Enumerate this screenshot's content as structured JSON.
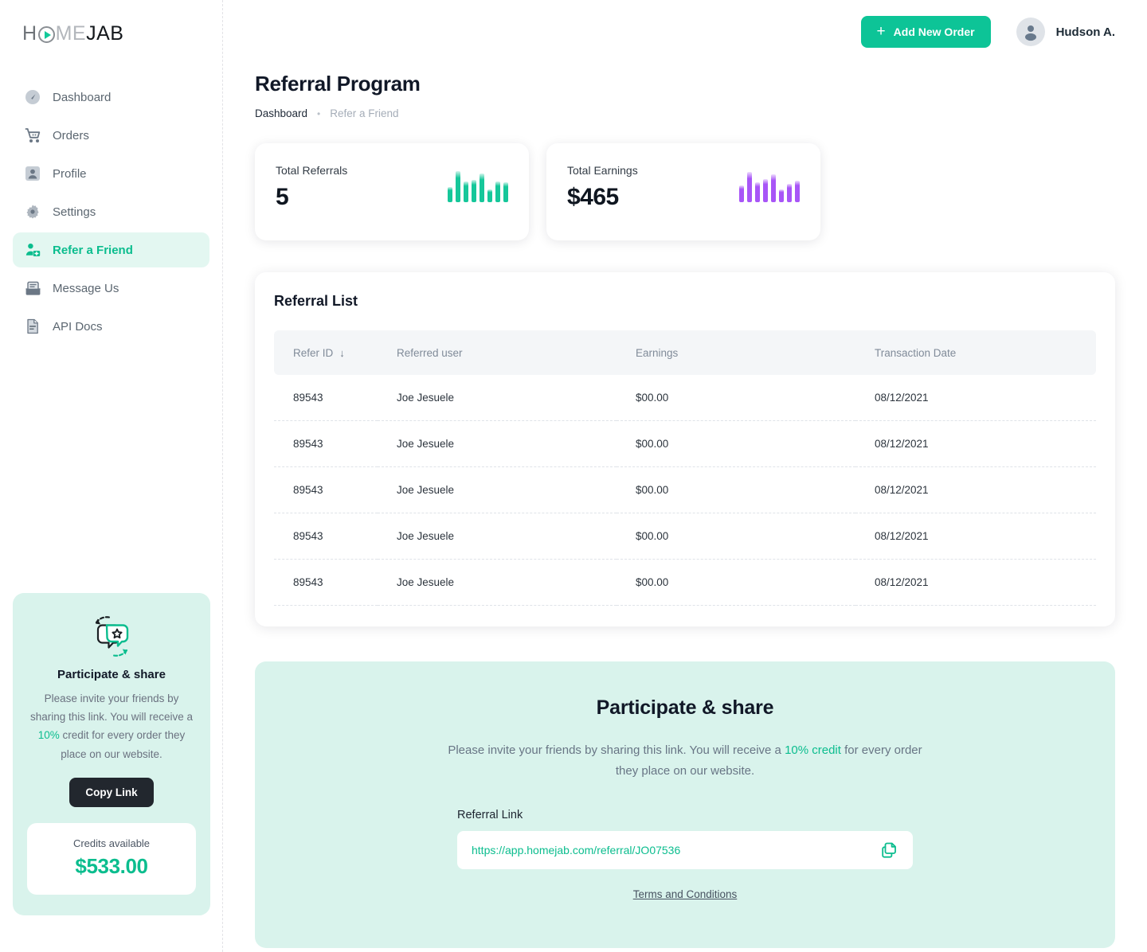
{
  "brand": {
    "logo_part1": "H",
    "logo_part2": "ME",
    "logo_part3": "JAB",
    "accent": "#0bbd8e",
    "accent_button": "#0dc497",
    "mint_bg": "#d9f3ec",
    "purple": "#a855f7"
  },
  "sidebar": {
    "items": [
      {
        "label": "Dashboard",
        "icon": "gauge-icon",
        "active": false
      },
      {
        "label": "Orders",
        "icon": "cart-icon",
        "active": false
      },
      {
        "label": "Profile",
        "icon": "user-icon",
        "active": false
      },
      {
        "label": "Settings",
        "icon": "gear-icon",
        "active": false
      },
      {
        "label": "Refer a Friend",
        "icon": "user-add-icon",
        "active": true
      },
      {
        "label": "Message Us",
        "icon": "inbox-icon",
        "active": false
      },
      {
        "label": "API Docs",
        "icon": "document-icon",
        "active": false
      }
    ],
    "promo": {
      "icon": "speech-bubbles-star-icon",
      "title": "Participate & share",
      "text_before": "Please invite your friends by sharing this link. You will receive a ",
      "highlight": "10%",
      "text_after": " credit for every order they place on our website.",
      "copy_button": "Copy Link",
      "credits_label": "Credits available",
      "credits_value": "$533.00"
    }
  },
  "header": {
    "add_order_button": "Add New Order",
    "add_order_icon": "plus-icon",
    "user_name": "Hudson A.",
    "avatar_icon": "user-avatar-icon"
  },
  "page": {
    "title": "Referral Program",
    "breadcrumb_parent": "Dashboard",
    "breadcrumb_separator": "•",
    "breadcrumb_current": "Refer a Friend"
  },
  "stats": [
    {
      "label": "Total Referrals",
      "value": "5",
      "icon": "bar-chart-icon",
      "color": "#16c79a"
    },
    {
      "label": "Total Earnings",
      "value": "$465",
      "icon": "bar-chart-icon",
      "color": "#a855f7"
    }
  ],
  "referral_list": {
    "title": "Referral List",
    "sort_icon": "arrow-down-icon",
    "columns": [
      "Refer ID",
      "Referred user",
      "Earnings",
      "Transaction Date"
    ],
    "rows": [
      {
        "refer_id": "89543",
        "referred_user": "Joe Jesuele",
        "earnings": "$00.00",
        "transaction_date": "08/12/2021"
      },
      {
        "refer_id": "89543",
        "referred_user": "Joe Jesuele",
        "earnings": "$00.00",
        "transaction_date": "08/12/2021"
      },
      {
        "refer_id": "89543",
        "referred_user": "Joe Jesuele",
        "earnings": "$00.00",
        "transaction_date": "08/12/2021"
      },
      {
        "refer_id": "89543",
        "referred_user": "Joe Jesuele",
        "earnings": "$00.00",
        "transaction_date": "08/12/2021"
      },
      {
        "refer_id": "89543",
        "referred_user": "Joe Jesuele",
        "earnings": "$00.00",
        "transaction_date": "08/12/2021"
      }
    ]
  },
  "participate": {
    "title": "Participate & share",
    "text_before": "Please invite your friends by sharing this link. You will receive a ",
    "highlight": "10% credit",
    "text_after": " for every order they place on our website.",
    "link_label": "Referral Link",
    "link_value": "https://app.homejab.com/referral/JO07536",
    "copy_icon": "copy-icon",
    "terms_link": "Terms and Conditions"
  },
  "chart_data": [
    {
      "type": "bar",
      "title": "Total Referrals",
      "categories": [
        "1",
        "2",
        "3",
        "4",
        "5",
        "6",
        "7",
        "8"
      ],
      "values": [
        16,
        33,
        22,
        24,
        31,
        14,
        22,
        21
      ],
      "color": "#16c79a",
      "ylim": [
        0,
        34
      ],
      "xlabel": "",
      "ylabel": "",
      "grid": false,
      "legend": "none"
    },
    {
      "type": "bar",
      "title": "Total Earnings",
      "categories": [
        "1",
        "2",
        "3",
        "4",
        "5",
        "6",
        "7",
        "8"
      ],
      "values": [
        18,
        32,
        21,
        25,
        30,
        14,
        20,
        23
      ],
      "color": "#a855f7",
      "ylim": [
        0,
        34
      ],
      "xlabel": "",
      "ylabel": "",
      "grid": false,
      "legend": "none"
    }
  ]
}
